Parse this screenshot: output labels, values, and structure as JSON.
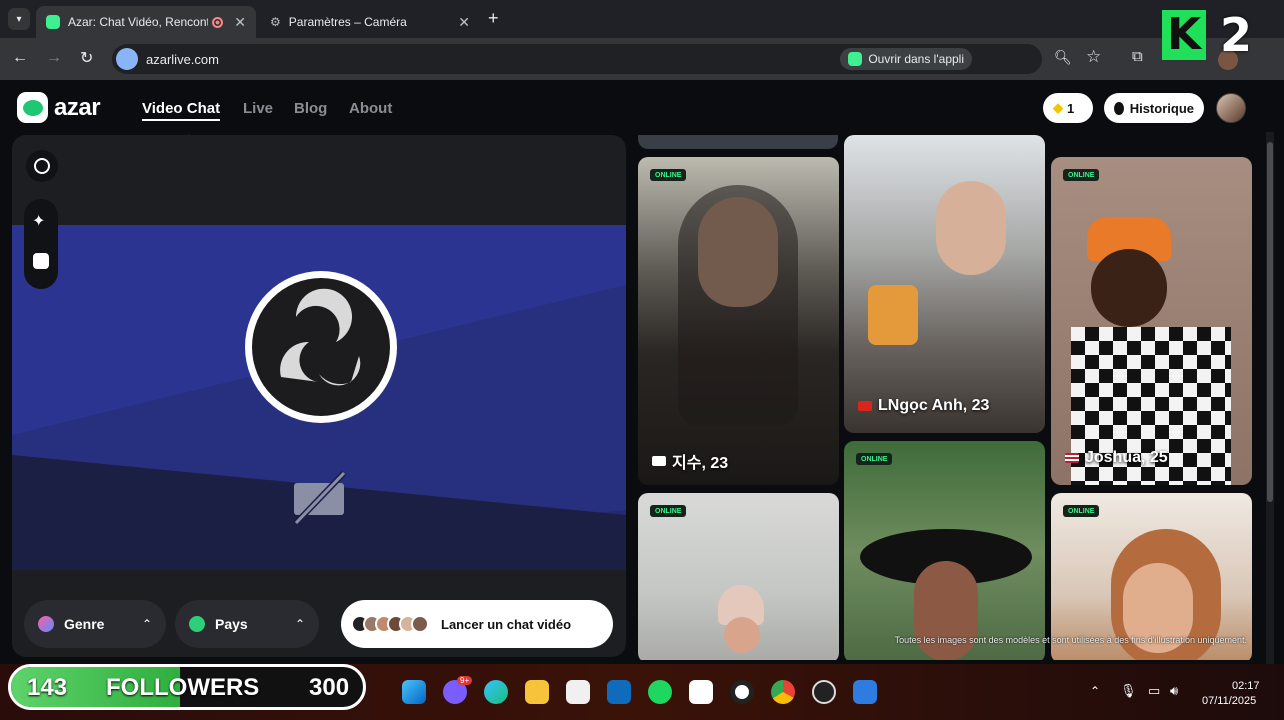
{
  "browser": {
    "tabs": [
      {
        "title": "Azar: Chat Vidéo, Rencontre",
        "active": true
      },
      {
        "title": "Paramètres – Caméra",
        "active": false
      }
    ],
    "new_tab_symbol": "+",
    "url": "azarlive.com",
    "open_in_app_label": "Ouvrir dans l'appli"
  },
  "overlay": {
    "badge_letter": "K",
    "badge_number": "2",
    "followers_current": "143",
    "followers_label": "FOLLOWERS",
    "followers_goal": "300"
  },
  "site": {
    "logo_text": "azar",
    "nav": [
      "Video Chat",
      "Live",
      "Blog",
      "About"
    ],
    "gems_count": "1",
    "history_label": "Historique",
    "footer_bar": {
      "genre_label": "Genre",
      "pays_label": "Pays",
      "start_label": "Lancer un chat vidéo"
    },
    "disclaimer": "Toutes les images sont des modèles et sont utilisées à des fins d'illustration uniquement.",
    "cards": [
      {
        "status": "ONLINE",
        "name": "지수, 23"
      },
      {
        "status": "",
        "name": "LNgọc Anh, 23"
      },
      {
        "status": "ONLINE",
        "name": "Joshua, 25"
      },
      {
        "status": "ONLINE",
        "name": ""
      },
      {
        "status": "ONLINE",
        "name": ""
      },
      {
        "status": "ONLINE",
        "name": ""
      }
    ]
  },
  "system": {
    "time": "02:17",
    "date": "07/11/2025",
    "notification_badge": "9+"
  },
  "colors": {
    "accent_green": "#3ef08f",
    "video_blue": "#2a3488",
    "browser_dark": "#35363a"
  }
}
